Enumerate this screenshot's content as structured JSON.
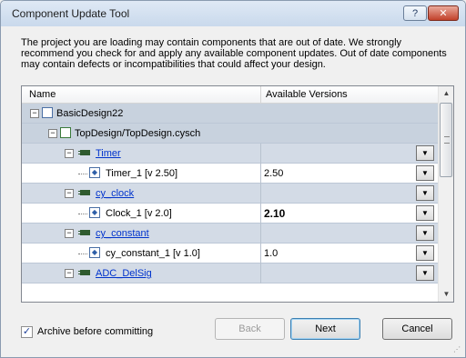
{
  "window": {
    "title": "Component Update Tool",
    "help_label": "?",
    "close_label": "✕"
  },
  "intro_text": "The project you are loading may contain components that are out of date. We strongly recommend you check for and apply any available component updates. Out of date components may contain defects or incompatibilities that could affect your design.",
  "grid": {
    "col_name": "Name",
    "col_versions": "Available Versions",
    "project": {
      "name": "BasicDesign22",
      "expander": "−"
    },
    "schematic": {
      "name": "TopDesign/TopDesign.cysch",
      "expander": "−"
    },
    "components": [
      {
        "name": "Timer",
        "expander": "−",
        "instance": "Timer_1 [v 2.50]",
        "version": "2.50",
        "bold": false
      },
      {
        "name": "cy_clock",
        "expander": "−",
        "instance": "Clock_1 [v 2.0]",
        "version": "2.10",
        "bold": true
      },
      {
        "name": "cy_constant",
        "expander": "−",
        "instance": "cy_constant_1 [v 1.0]",
        "version": "1.0",
        "bold": false
      },
      {
        "name": "ADC_DelSig",
        "expander": "−"
      }
    ],
    "dropdown_glyph": "▼",
    "scroll_up": "▲",
    "scroll_down": "▼"
  },
  "footer": {
    "archive_checked": "✓",
    "archive_label": "Archive before committing",
    "back_label": "Back",
    "next_label": "Next",
    "cancel_label": "Cancel"
  },
  "colors": {
    "link": "#0033cc",
    "close_button": "#c2412a",
    "accent": "#3c7fb1"
  }
}
